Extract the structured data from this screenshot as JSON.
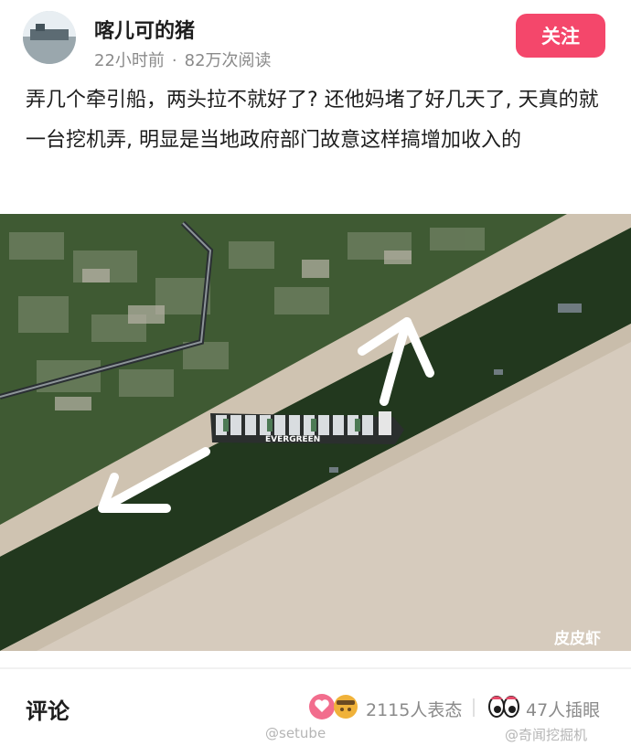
{
  "post": {
    "author": "喀儿可的猪",
    "time": "22小时前",
    "separator": "·",
    "views": "82万次阅读",
    "follow_label": "关注",
    "text": "弄几个牵引船，两头拉不就好了? 还他妈堵了好几天了, 天真的就一台挖机弄, 明显是当地政府部门故意这样搞增加收入的"
  },
  "image": {
    "ship_label": "EVERGREEN",
    "watermark": "皮皮虾"
  },
  "footer": {
    "comments_title": "评论",
    "reactions_text": "2115人表态",
    "eyes_text": "47人插眼",
    "watermark_left": "@setube",
    "watermark_right": "@奇闻挖掘机"
  },
  "colors": {
    "follow_bg": "#f4476b",
    "water": "#243a1f",
    "sand": "#d6cbbd"
  },
  "icons": [
    "avatar",
    "like-heart-icon",
    "emoji-icon",
    "eyes-icon"
  ]
}
